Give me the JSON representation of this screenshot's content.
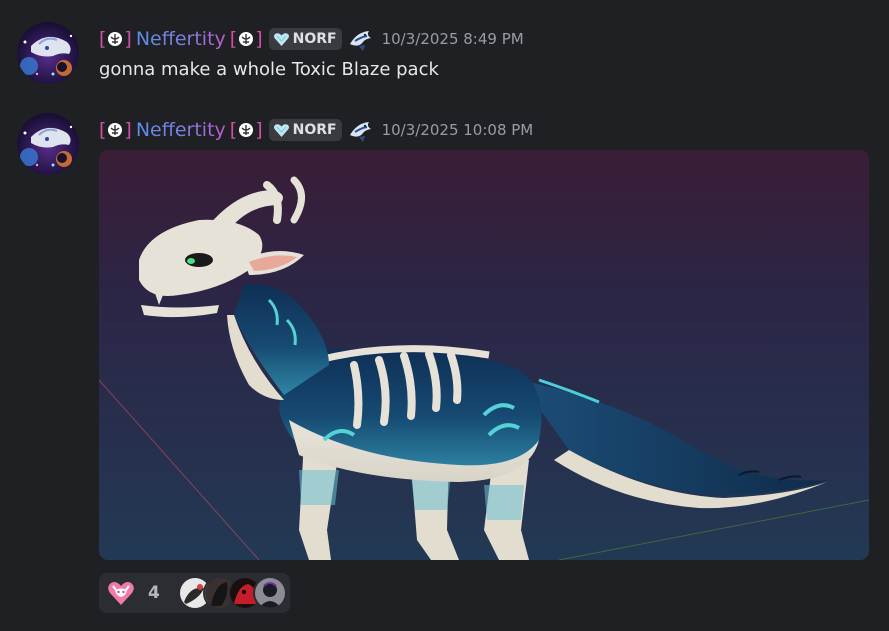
{
  "messages": [
    {
      "bracket_open": "[",
      "bracket_close": "]",
      "username": "Neffertity",
      "tag": "NORF",
      "timestamp": "10/3/2025 8:49 PM",
      "text": "gonna make a whole Toxic Blaze pack"
    },
    {
      "bracket_open": "[",
      "bracket_close": "]",
      "username": "Neffertity",
      "tag": "NORF",
      "timestamp": "10/3/2025 10:08 PM",
      "attachment_icon": "dragon-3d-render-image"
    }
  ],
  "reaction": {
    "emoji": "pink-heart-dragon-emoji",
    "count": "4"
  },
  "colors": {
    "background": "#1f2023",
    "username_gradient_start": "#5c8de8",
    "username_gradient_end": "#c05ad0",
    "bracket": "#d04fa6",
    "timestamp": "#9a9ca3",
    "message_text": "#e6e7ea"
  }
}
